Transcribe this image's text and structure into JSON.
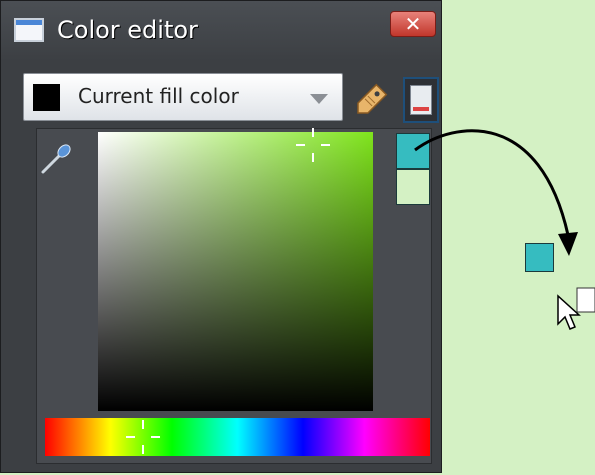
{
  "window": {
    "title": "Color editor",
    "close_glyph": "✕"
  },
  "color_dropdown": {
    "selected": "Current fill color"
  },
  "colors": {
    "current_fill": "#000000",
    "new_color": "#36bcc0",
    "old_color": "#d4f1c4",
    "hue_base": "#7fe41c"
  },
  "icons": [
    "app-window-icon",
    "close-icon",
    "chevron-down-icon",
    "tag-icon",
    "panel-toggle-icon",
    "eyedropper-icon",
    "drag-arrow",
    "mouse-pointer-icon"
  ]
}
